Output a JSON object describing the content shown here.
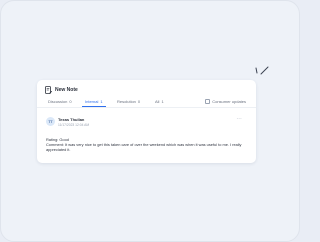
{
  "card": {
    "title": "New Note",
    "icon": "note-icon"
  },
  "tabs": [
    {
      "label": "Discussion",
      "count": "0",
      "active": false
    },
    {
      "label": "Internal",
      "count": "1",
      "active": true
    },
    {
      "label": "Resolution",
      "count": "0",
      "active": false
    },
    {
      "label": "All",
      "count": "1",
      "active": false
    }
  ],
  "filter": {
    "consumer_label": "Consumer updates",
    "checked": false
  },
  "note": {
    "avatar_initials": "TT",
    "author": "Texas Thullan",
    "timestamp": "11/17/2023 12:04 AM",
    "more_label": "···",
    "rating_line": "Rating: Good",
    "comment_line": "Comment: It was very nice to get this taken care of over the weekend which was when it was useful to me. I really appreciated it."
  },
  "colors": {
    "accent": "#2f6fed",
    "background": "#eef2f8",
    "card": "#ffffff"
  }
}
